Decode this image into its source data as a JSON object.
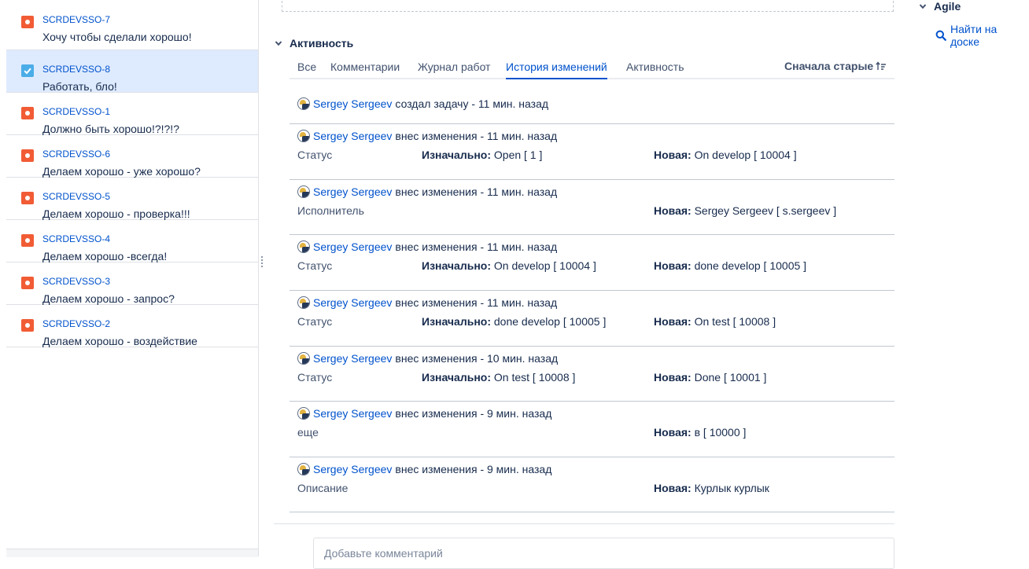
{
  "issues": [
    {
      "key": "SCRDEVSSO-7",
      "summary": "Хочу чтобы сделали хорошо!",
      "type": "bug",
      "selected": false
    },
    {
      "key": "SCRDEVSSO-8",
      "summary": "Работать, бло!",
      "type": "task",
      "selected": true
    },
    {
      "key": "SCRDEVSSO-1",
      "summary": "Должно быть хорошо!?!?!?",
      "type": "bug",
      "selected": false
    },
    {
      "key": "SCRDEVSSO-6",
      "summary": "Делаем хорошо - уже хорошо?",
      "type": "bug",
      "selected": false
    },
    {
      "key": "SCRDEVSSO-5",
      "summary": "Делаем хорошо - проверка!!!",
      "type": "bug",
      "selected": false
    },
    {
      "key": "SCRDEVSSO-4",
      "summary": "Делаем хорошо -всегда!",
      "type": "bug",
      "selected": false
    },
    {
      "key": "SCRDEVSSO-3",
      "summary": "Делаем хорошо - запрос?",
      "type": "bug",
      "selected": false
    },
    {
      "key": "SCRDEVSSO-2",
      "summary": "Делаем хорошо - воздействие",
      "type": "bug",
      "selected": false
    }
  ],
  "activity": {
    "title": "Активность",
    "tabs": [
      "Все",
      "Комментарии",
      "Журнал работ",
      "История изменений",
      "Активность"
    ],
    "active_tab": "История изменений",
    "sort_label": "Сначала старые",
    "entries": [
      {
        "user": "Sergey Sergeev",
        "action": "создал задачу - 11 мин. назад",
        "field": "",
        "old_label": "",
        "old_value": "",
        "new_label": "",
        "new_value": ""
      },
      {
        "user": "Sergey Sergeev",
        "action": "внес изменения - 11 мин. назад",
        "field": "Статус",
        "old_label": "Изначально:",
        "old_value": "Open [ 1 ]",
        "new_label": "Новая:",
        "new_value": "On develop [ 10004 ]"
      },
      {
        "user": "Sergey Sergeev",
        "action": "внес изменения - 11 мин. назад",
        "field": "Исполнитель",
        "old_label": "",
        "old_value": "",
        "new_label": "Новая:",
        "new_value": "Sergey Sergeev [ s.sergeev ]"
      },
      {
        "user": "Sergey Sergeev",
        "action": "внес изменения - 11 мин. назад",
        "field": "Статус",
        "old_label": "Изначально:",
        "old_value": "On develop [ 10004 ]",
        "new_label": "Новая:",
        "new_value": "done develop [ 10005 ]"
      },
      {
        "user": "Sergey Sergeev",
        "action": "внес изменения - 11 мин. назад",
        "field": "Статус",
        "old_label": "Изначально:",
        "old_value": "done develop [ 10005 ]",
        "new_label": "Новая:",
        "new_value": "On test [ 10008 ]"
      },
      {
        "user": "Sergey Sergeev",
        "action": "внес изменения - 10 мин. назад",
        "field": "Статус",
        "old_label": "Изначально:",
        "old_value": "On test [ 10008 ]",
        "new_label": "Новая:",
        "new_value": "Done [ 10001 ]"
      },
      {
        "user": "Sergey Sergeev",
        "action": "внес изменения - 9 мин. назад",
        "field": "еще",
        "old_label": "",
        "old_value": "",
        "new_label": "Новая:",
        "new_value": "в [ 10000 ]"
      },
      {
        "user": "Sergey Sergeev",
        "action": "внес изменения - 9 мин. назад",
        "field": "Описание",
        "old_label": "",
        "old_value": "",
        "new_label": "Новая:",
        "new_value": "Курлык курлык"
      }
    ],
    "comment_placeholder": "Добавьте комментарий"
  },
  "agile": {
    "title": "Agile",
    "find_on_board": "Найти на доске"
  },
  "colors": {
    "link": "#0052cc",
    "bug": "#f15c35",
    "task": "#4bade8",
    "selected_row": "#deebff"
  }
}
